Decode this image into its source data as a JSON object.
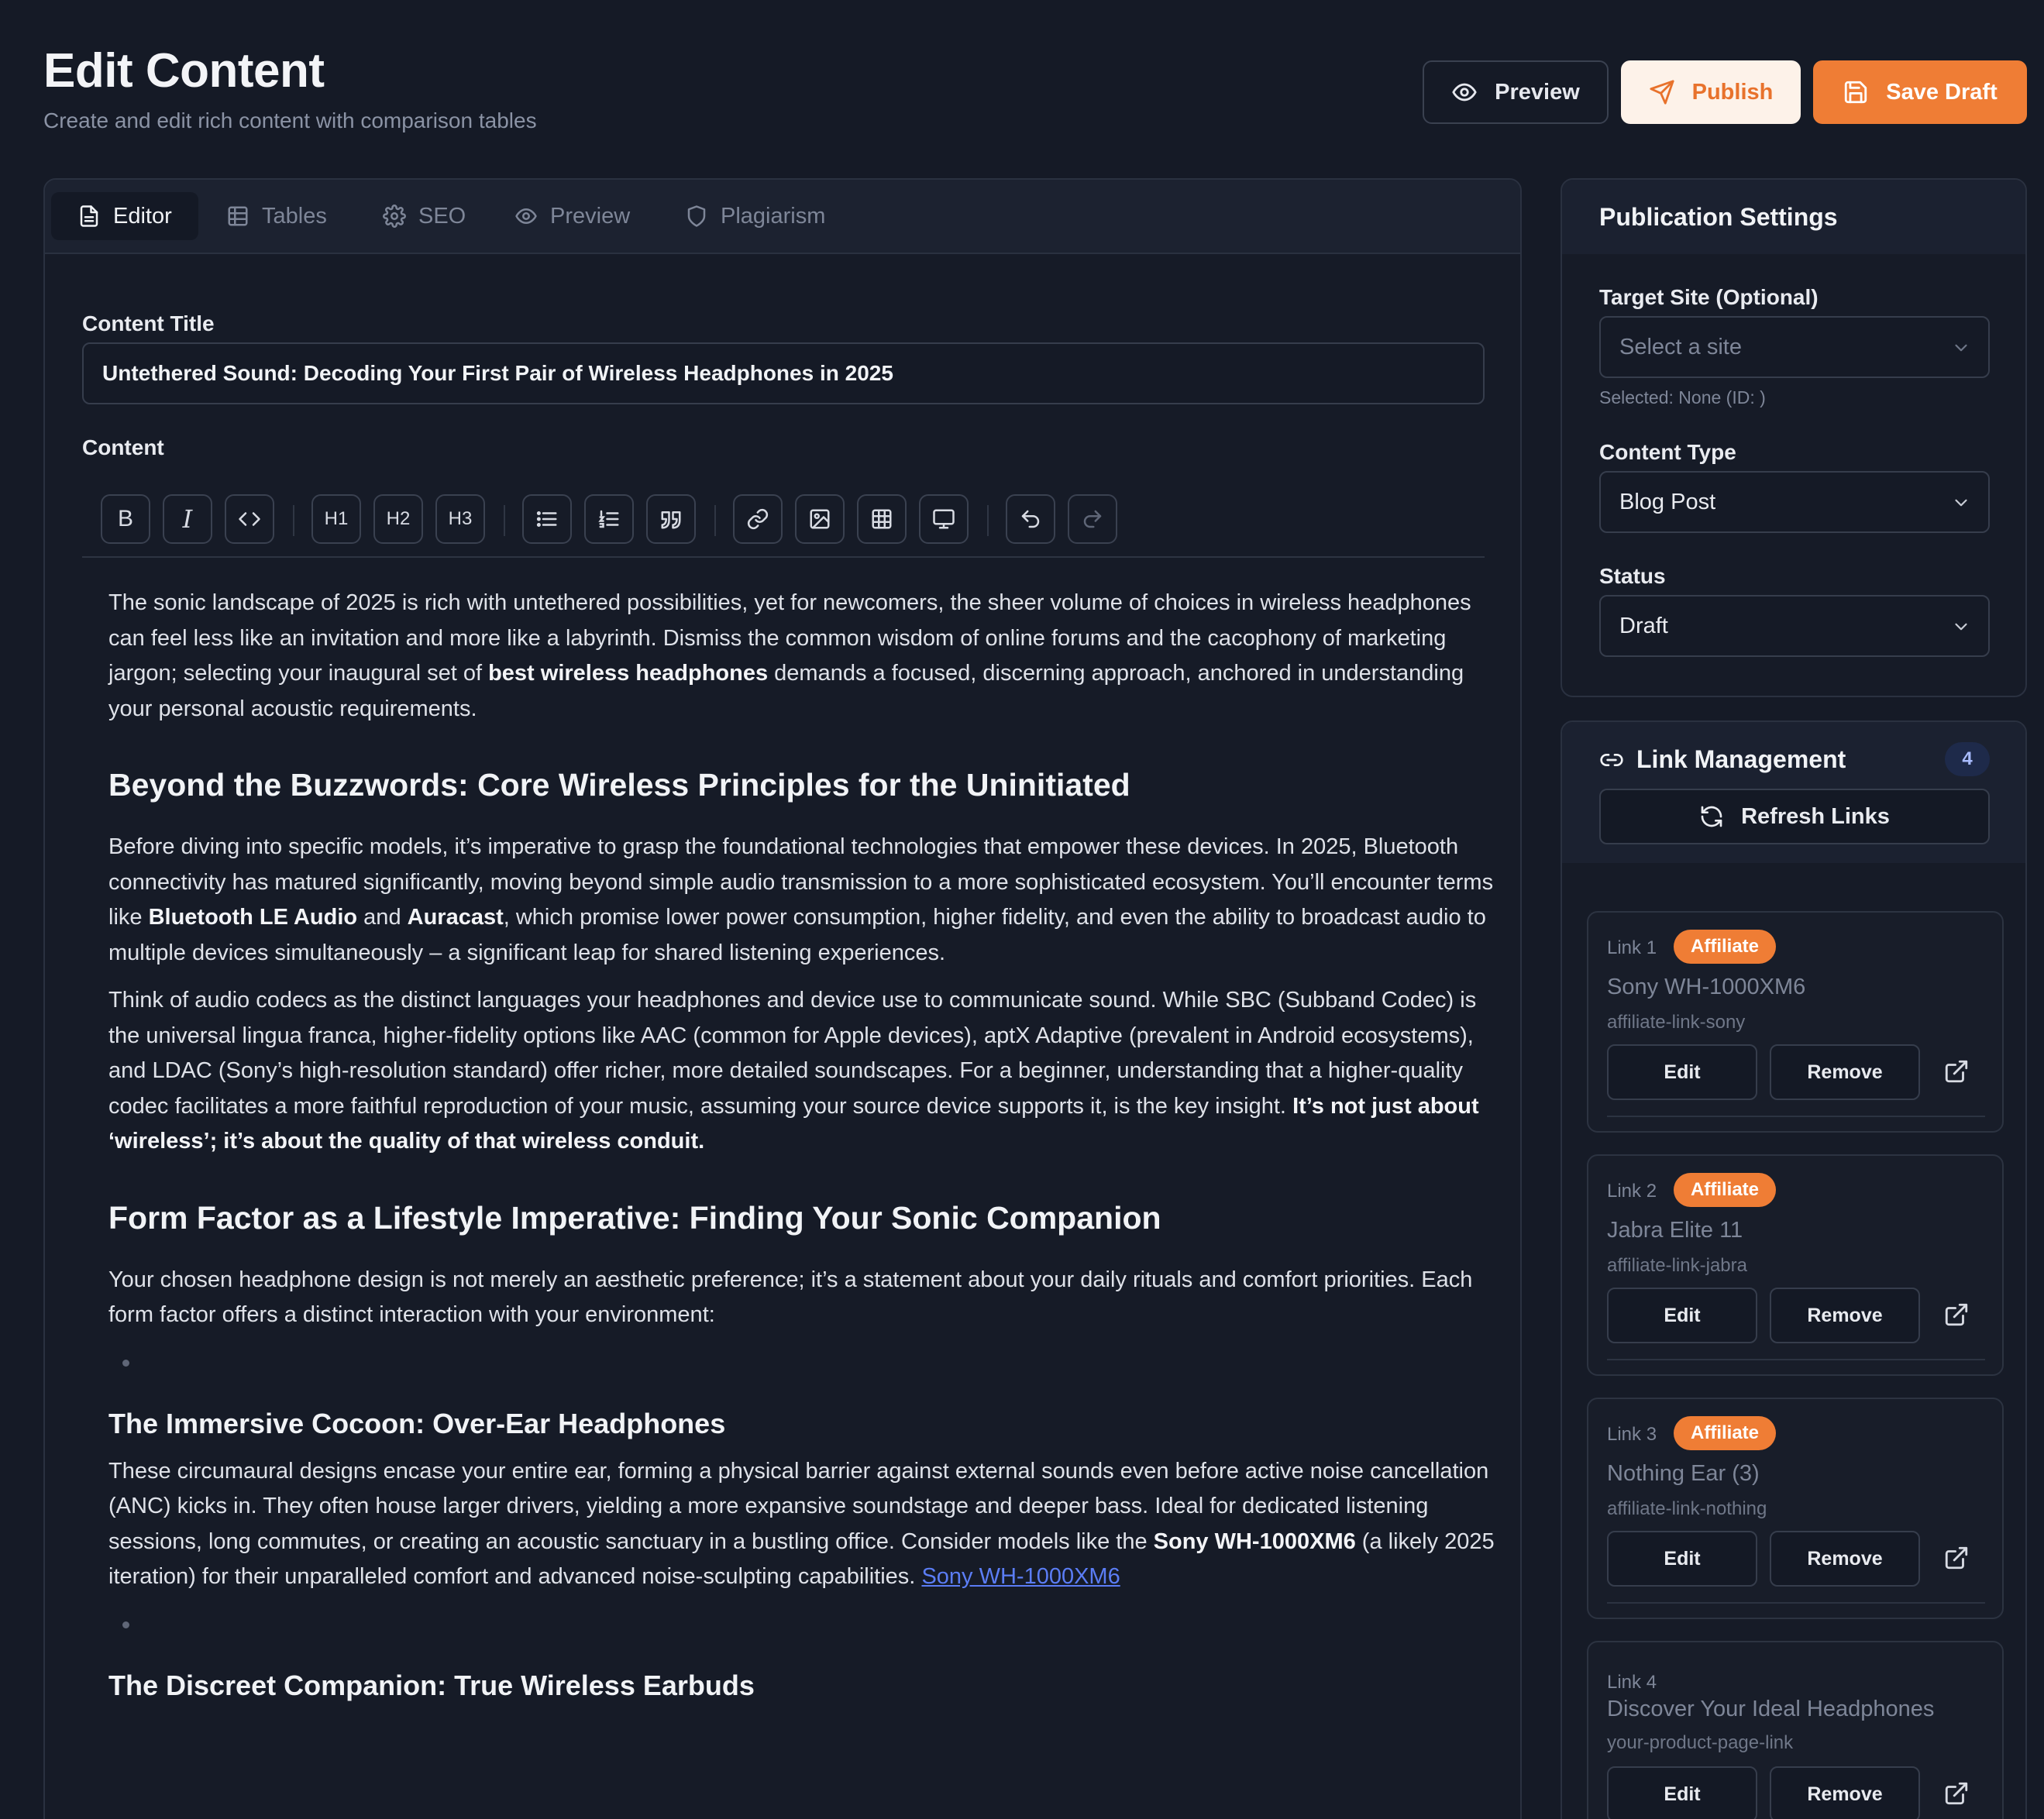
{
  "header": {
    "title": "Edit Content",
    "subtitle": "Create and edit rich content with comparison tables",
    "preview_label": "Preview",
    "publish_label": "Publish",
    "save_label": "Save Draft"
  },
  "tabs": [
    {
      "label": "Editor",
      "icon": "document-icon",
      "active": true
    },
    {
      "label": "Tables",
      "icon": "table-icon",
      "active": false
    },
    {
      "label": "SEO",
      "icon": "gear-icon",
      "active": false
    },
    {
      "label": "Preview",
      "icon": "eye-icon",
      "active": false
    },
    {
      "label": "Plagiarism",
      "icon": "shield-icon",
      "active": false
    }
  ],
  "editor": {
    "title_label": "Content Title",
    "title_value": "Untethered Sound: Decoding Your First Pair of Wireless Headphones in 2025",
    "content_label": "Content",
    "toolbar": {
      "bold": "B",
      "italic": "I",
      "h1": "H1",
      "h2": "H2",
      "h3": "H3"
    },
    "body": {
      "p1a": "The sonic landscape of 2025 is rich with untethered possibilities, yet for newcomers, the sheer volume of choices in wireless headphones can feel less like an invitation and more like a labyrinth. Dismiss the common wisdom of online forums and the cacophony of marketing jargon; selecting your inaugural set of ",
      "p1b": "best wireless headphones",
      "p1c": " demands a focused, discerning approach, anchored in understanding your personal acoustic requirements.",
      "h2a": "Beyond the Buzzwords: Core Wireless Principles for the Uninitiated",
      "p2a": "Before diving into specific models, it’s imperative to grasp the foundational technologies that empower these devices. In 2025, Bluetooth connectivity has matured significantly, moving beyond simple audio transmission to a more sophisticated ecosystem. You’ll encounter terms like ",
      "p2b": "Bluetooth LE Audio",
      "p2c": " and ",
      "p2d": "Auracast",
      "p2e": ", which promise lower power consumption, higher fidelity, and even the ability to broadcast audio to multiple devices simultaneously – a significant leap for shared listening experiences.",
      "p3a": "Think of audio codecs as the distinct languages your headphones and device use to communicate sound. While SBC (Subband Codec) is the universal lingua franca, higher-fidelity options like AAC (common for Apple devices), aptX Adaptive (prevalent in Android ecosystems), and LDAC (Sony’s high-resolution standard) offer richer, more detailed soundscapes. For a beginner, understanding that a higher-quality codec facilitates a more faithful reproduction of your music, assuming your source device supports it, is the key insight. ",
      "p3b": "It’s not just about ‘wireless’; it’s about the quality of that wireless conduit.",
      "h2b": "Form Factor as a Lifestyle Imperative: Finding Your Sonic Companion",
      "p4": "Your chosen headphone design is not merely an aesthetic preference; it’s a statement about your daily rituals and comfort priorities. Each form factor offers a distinct interaction with your environment:",
      "h3a": "The Immersive Cocoon: Over-Ear Headphones",
      "p5a": "These circumaural designs encase your entire ear, forming a physical barrier against external sounds even before active noise cancellation (ANC) kicks in. They often house larger drivers, yielding a more expansive soundstage and deeper bass. Ideal for dedicated listening sessions, long commutes, or creating an acoustic sanctuary in a bustling office. Consider models like the ",
      "p5b": "Sony WH-1000XM6",
      "p5c": " (a likely 2025 iteration) for their unparalleled comfort and advanced noise-sculpting capabilities. ",
      "p5link": "Sony WH-1000XM6",
      "h3b": "The Discreet Companion: True Wireless Earbuds"
    }
  },
  "publication": {
    "title": "Publication Settings",
    "target_label": "Target Site (Optional)",
    "target_placeholder": "Select a site",
    "target_hint": "Selected: None (ID: )",
    "type_label": "Content Type",
    "type_value": "Blog Post",
    "status_label": "Status",
    "status_value": "Draft"
  },
  "links": {
    "title": "Link Management",
    "count": "4",
    "refresh_label": "Refresh Links",
    "edit_label": "Edit",
    "remove_label": "Remove",
    "items": [
      {
        "num": "Link 1",
        "tag": "Affiliate",
        "name": "Sony WH-1000XM6",
        "slug": "affiliate-link-sony"
      },
      {
        "num": "Link 2",
        "tag": "Affiliate",
        "name": "Jabra Elite 11",
        "slug": "affiliate-link-jabra"
      },
      {
        "num": "Link 3",
        "tag": "Affiliate",
        "name": "Nothing Ear (3)",
        "slug": "affiliate-link-nothing"
      },
      {
        "num": "Link 4",
        "tag": "",
        "name": "Discover Your Ideal Headphones",
        "slug": "your-product-page-link"
      }
    ]
  },
  "colors": {
    "background": "#151a26",
    "accent": "#ef7d35",
    "link": "#5b7df5",
    "badge": "#1e2a4a"
  }
}
